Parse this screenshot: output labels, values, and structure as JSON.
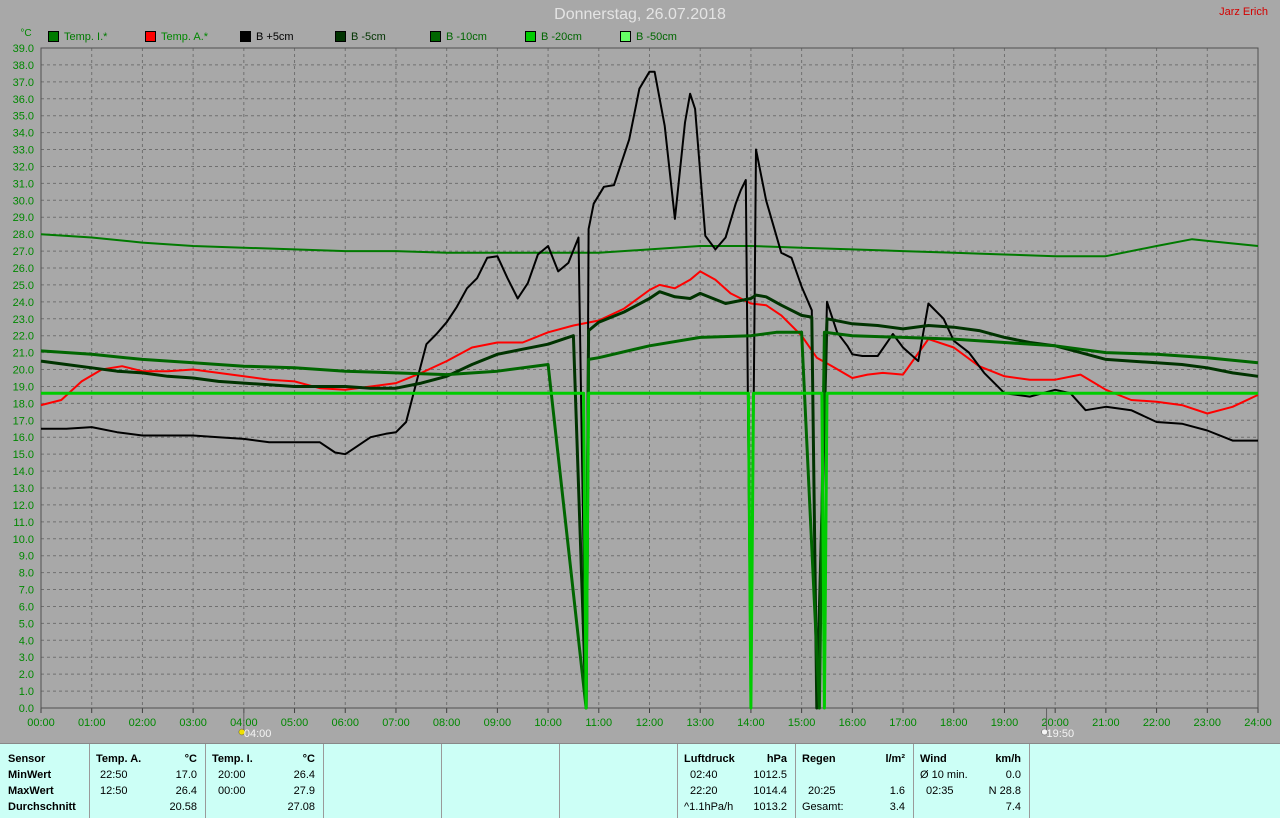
{
  "title": "Donnerstag, 26.07.2018",
  "author": "Jarz Erich",
  "colors": {
    "background": "#a8a8a8",
    "grid": "#707070",
    "axis_text": "#008800",
    "panel_bg": "#ccfff6"
  },
  "chart_data": {
    "type": "line",
    "ylabel": "°C",
    "ylim": [
      0.0,
      39.0
    ],
    "yticks": [
      "0.0",
      "1.0",
      "2.0",
      "3.0",
      "4.0",
      "5.0",
      "6.0",
      "7.0",
      "8.0",
      "9.0",
      "10.0",
      "11.0",
      "12.0",
      "13.0",
      "14.0",
      "15.0",
      "16.0",
      "17.0",
      "18.0",
      "19.0",
      "20.0",
      "21.0",
      "22.0",
      "23.0",
      "24.0",
      "25.0",
      "26.0",
      "27.0",
      "28.0",
      "29.0",
      "30.0",
      "31.0",
      "32.0",
      "33.0",
      "34.0",
      "35.0",
      "36.0",
      "37.0",
      "38.0",
      "39.0"
    ],
    "xlim": [
      0,
      24
    ],
    "xticks": [
      "00:00",
      "01:00",
      "02:00",
      "03:00",
      "04:00",
      "05:00",
      "06:00",
      "07:00",
      "08:00",
      "09:00",
      "10:00",
      "11:00",
      "12:00",
      "13:00",
      "14:00",
      "15:00",
      "16:00",
      "17:00",
      "18:00",
      "19:00",
      "20:00",
      "21:00",
      "22:00",
      "23:00",
      "24:00"
    ],
    "grid": true,
    "legend_position": "top",
    "markers": [
      {
        "x": 4.0,
        "label": "04:00",
        "icon": "sunrise-icon"
      },
      {
        "x": 19.83,
        "label": "19:50",
        "icon": "sunset-icon"
      }
    ],
    "series": [
      {
        "name": "Temp. I.*",
        "color": "#007a00",
        "width": 2,
        "x": [
          0,
          1,
          2,
          3,
          4,
          5,
          6,
          7,
          8,
          9,
          10,
          11,
          12,
          13,
          14,
          15,
          16,
          17,
          18,
          19,
          20,
          21,
          22,
          22.7,
          23,
          24
        ],
        "y": [
          28.0,
          27.8,
          27.5,
          27.3,
          27.2,
          27.1,
          27.0,
          27.0,
          26.9,
          26.9,
          26.9,
          26.9,
          27.1,
          27.3,
          27.3,
          27.2,
          27.1,
          27.0,
          26.9,
          26.8,
          26.7,
          26.7,
          27.3,
          27.7,
          27.6,
          27.3
        ]
      },
      {
        "name": "Temp. A.*",
        "color": "#ff0000",
        "width": 2,
        "x": [
          0,
          0.4,
          0.8,
          1.2,
          1.6,
          2.0,
          2.5,
          3.0,
          3.5,
          4.0,
          4.5,
          5.0,
          5.5,
          6.0,
          6.5,
          7.0,
          7.5,
          8.0,
          8.5,
          9.0,
          9.5,
          10.0,
          10.5,
          11.0,
          11.5,
          12.0,
          12.2,
          12.5,
          12.8,
          13.0,
          13.3,
          13.6,
          14.0,
          14.3,
          14.6,
          15.0,
          15.3,
          15.6,
          16.0,
          16.3,
          16.6,
          17.0,
          17.5,
          18.0,
          18.5,
          19.0,
          19.5,
          20.0,
          20.5,
          21.0,
          21.5,
          22.0,
          22.5,
          23.0,
          23.5,
          24.0
        ],
        "y": [
          17.9,
          18.2,
          19.3,
          20.0,
          20.2,
          19.9,
          19.9,
          20.0,
          19.8,
          19.6,
          19.4,
          19.3,
          18.9,
          18.8,
          19.0,
          19.2,
          19.8,
          20.5,
          21.3,
          21.6,
          21.6,
          22.2,
          22.6,
          22.9,
          23.6,
          24.7,
          25.0,
          24.8,
          25.3,
          25.8,
          25.3,
          24.5,
          23.9,
          23.8,
          23.2,
          22.0,
          20.7,
          20.2,
          19.5,
          19.7,
          19.8,
          19.7,
          21.8,
          21.3,
          20.2,
          19.6,
          19.4,
          19.4,
          19.7,
          18.8,
          18.2,
          18.1,
          17.9,
          17.4,
          17.8,
          18.5
        ]
      },
      {
        "name": "B +5cm",
        "color": "#000000",
        "width": 2,
        "x": [
          0,
          0.5,
          1.0,
          1.5,
          2.0,
          2.5,
          3.0,
          3.5,
          4.0,
          4.5,
          5.0,
          5.5,
          5.8,
          6.0,
          6.2,
          6.5,
          6.8,
          7.0,
          7.2,
          7.4,
          7.6,
          7.8,
          8.0,
          8.2,
          8.4,
          8.6,
          8.8,
          9.0,
          9.2,
          9.4,
          9.6,
          9.8,
          10.0,
          10.2,
          10.4,
          10.6,
          10.75,
          10.8,
          10.9,
          11.1,
          11.3,
          11.6,
          11.8,
          12.0,
          12.1,
          12.3,
          12.5,
          12.7,
          12.8,
          12.9,
          13.1,
          13.3,
          13.5,
          13.7,
          13.8,
          13.9,
          14.0,
          14.1,
          14.3,
          14.6,
          14.8,
          15.0,
          15.2,
          15.3,
          15.5,
          15.7,
          15.9,
          16.0,
          16.2,
          16.5,
          16.8,
          17.0,
          17.3,
          17.5,
          17.8,
          18.0,
          18.3,
          18.6,
          19.0,
          19.5,
          20.0,
          20.3,
          20.6,
          21.0,
          21.5,
          22.0,
          22.5,
          23.0,
          23.5,
          24.0
        ],
        "y": [
          16.5,
          16.5,
          16.6,
          16.3,
          16.1,
          16.1,
          16.1,
          16.0,
          15.9,
          15.7,
          15.7,
          15.7,
          15.1,
          15.0,
          15.4,
          16.0,
          16.2,
          16.3,
          16.9,
          19.2,
          21.5,
          22.1,
          22.8,
          23.7,
          24.8,
          25.4,
          26.6,
          26.7,
          25.4,
          24.2,
          25.1,
          26.8,
          27.3,
          25.8,
          26.3,
          27.8,
          0.0,
          28.3,
          29.8,
          30.8,
          30.9,
          33.6,
          36.6,
          37.6,
          37.6,
          34.4,
          28.9,
          34.6,
          36.3,
          35.4,
          27.9,
          27.1,
          27.8,
          29.8,
          30.6,
          31.2,
          0.0,
          33.0,
          30.0,
          26.9,
          26.6,
          24.9,
          23.5,
          0.0,
          24.0,
          22.2,
          21.4,
          20.9,
          20.8,
          20.8,
          22.1,
          21.3,
          20.5,
          23.9,
          23.0,
          21.7,
          21.0,
          19.8,
          18.6,
          18.4,
          18.8,
          18.6,
          17.6,
          17.8,
          17.6,
          16.9,
          16.8,
          16.4,
          15.8,
          15.8
        ]
      },
      {
        "name": "B -5cm",
        "color": "#003300",
        "width": 3,
        "x": [
          0,
          0.5,
          1.0,
          1.5,
          2.0,
          2.5,
          3.0,
          3.5,
          4.0,
          4.5,
          5.0,
          5.5,
          6.0,
          6.5,
          7.0,
          7.5,
          8.0,
          8.5,
          9.0,
          9.5,
          10.0,
          10.5,
          10.75,
          10.8,
          11.0,
          11.5,
          12.0,
          12.2,
          12.5,
          12.8,
          13.0,
          13.5,
          14.0,
          14.1,
          14.3,
          14.6,
          15.0,
          15.2,
          15.3,
          15.5,
          16.0,
          16.5,
          17.0,
          17.5,
          18.0,
          18.5,
          19.0,
          19.5,
          20.0,
          20.5,
          21.0,
          21.5,
          22.0,
          22.5,
          23.0,
          23.5,
          24.0
        ],
        "y": [
          20.5,
          20.3,
          20.1,
          19.9,
          19.8,
          19.6,
          19.5,
          19.3,
          19.2,
          19.1,
          19.0,
          19.0,
          19.0,
          18.9,
          18.9,
          19.2,
          19.6,
          20.3,
          20.9,
          21.2,
          21.5,
          22.0,
          0.0,
          22.3,
          22.8,
          23.4,
          24.2,
          24.6,
          24.3,
          24.2,
          24.5,
          23.9,
          24.2,
          24.4,
          24.3,
          23.8,
          23.2,
          23.1,
          0.0,
          23.0,
          22.7,
          22.6,
          22.4,
          22.6,
          22.5,
          22.3,
          21.9,
          21.6,
          21.4,
          21.0,
          20.6,
          20.5,
          20.4,
          20.3,
          20.1,
          19.8,
          19.6
        ]
      },
      {
        "name": "B -10cm",
        "color": "#006600",
        "width": 3,
        "x": [
          0,
          1,
          2,
          3,
          4,
          5,
          6,
          7,
          8,
          9,
          10,
          10.75,
          10.8,
          11,
          12,
          13,
          14,
          14.5,
          15,
          15.35,
          15.45,
          16,
          17,
          18,
          19,
          20,
          21,
          22,
          23,
          24
        ],
        "y": [
          21.1,
          20.9,
          20.6,
          20.4,
          20.2,
          20.1,
          19.9,
          19.8,
          19.7,
          19.9,
          20.3,
          0.0,
          20.6,
          20.7,
          21.4,
          21.9,
          22.0,
          22.2,
          22.2,
          0.0,
          22.2,
          22.0,
          21.9,
          21.8,
          21.6,
          21.4,
          21.0,
          20.9,
          20.7,
          20.4
        ]
      },
      {
        "name": "B -20cm",
        "color": "#00cc00",
        "width": 3,
        "x": [
          0,
          5,
          10,
          10.7,
          10.75,
          10.8,
          11,
          13.95,
          14.0,
          14.05,
          15,
          15.4,
          15.45,
          15.5,
          16,
          20,
          24
        ],
        "y": [
          18.6,
          18.6,
          18.6,
          18.6,
          0.0,
          18.6,
          18.6,
          18.6,
          0.0,
          18.6,
          18.6,
          18.6,
          0.0,
          18.6,
          18.6,
          18.6,
          18.6
        ]
      },
      {
        "name": "B -50cm",
        "color": "#66ff66",
        "width": 2,
        "x": [],
        "y": []
      }
    ]
  },
  "summary": {
    "sensor": {
      "header": "Sensor",
      "min": "MinWert",
      "max": "MaxWert",
      "avg": "Durchschnitt"
    },
    "temp_a": {
      "header": "Temp. A.",
      "unit": "°C",
      "min_time": "22:50",
      "min_val": "17.0",
      "max_time": "12:50",
      "max_val": "26.4",
      "avg": "20.58"
    },
    "temp_i": {
      "header": "Temp. I.",
      "unit": "°C",
      "min_time": "20:00",
      "min_val": "26.4",
      "max_time": "00:00",
      "max_val": "27.9",
      "avg": "27.08"
    },
    "pressure": {
      "header": "Luftdruck",
      "unit": "hPa",
      "min_time": "02:40",
      "min_val": "1012.5",
      "max_time": "22:20",
      "max_val": "1014.4",
      "trend_label": "^1.1hPa/h",
      "trend_val": "1013.2"
    },
    "rain": {
      "header": "Regen",
      "unit": "l/m²",
      "row2_time": "20:25",
      "row2_val": "1.6",
      "total_label": "Gesamt:",
      "total_val": "3.4"
    },
    "wind": {
      "header": "Wind",
      "unit": "km/h",
      "avg_label": "Ø 10 min.",
      "avg_val": "0.0",
      "gust_time": "02:35",
      "gust_val": "N 28.8",
      "row3_val": "7.4"
    }
  }
}
